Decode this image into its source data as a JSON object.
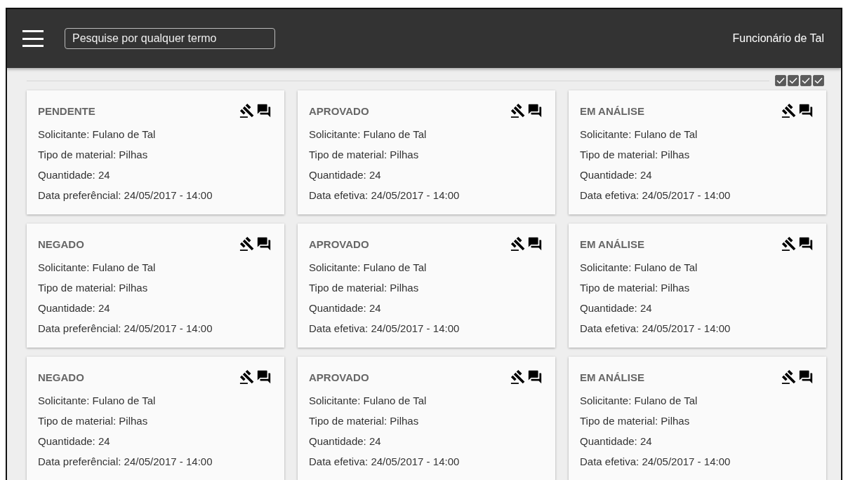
{
  "header": {
    "search": {
      "placeholder": "Pesquise por qualquer termo"
    },
    "user_name": "Funcionário de Tal"
  },
  "checkboxes": [
    {
      "checked": true
    },
    {
      "checked": true
    },
    {
      "checked": true
    },
    {
      "checked": true
    }
  ],
  "cards": [
    {
      "status": "PENDENTE",
      "lines": [
        "Solicitante: Fulano de Tal",
        "Tipo de material: Pilhas",
        "Quantidade: 24",
        "Data preferêncial: 24/05/2017 - 14:00"
      ]
    },
    {
      "status": "APROVADO",
      "lines": [
        "Solicitante: Fulano de Tal",
        "Tipo de material: Pilhas",
        "Quantidade: 24",
        "Data efetiva: 24/05/2017 - 14:00"
      ]
    },
    {
      "status": "EM ANÁLISE",
      "lines": [
        "Solicitante: Fulano de Tal",
        "Tipo de material: Pilhas",
        "Quantidade: 24",
        "Data efetiva: 24/05/2017 - 14:00"
      ]
    },
    {
      "status": "NEGADO",
      "lines": [
        "Solicitante: Fulano de Tal",
        "Tipo de material: Pilhas",
        "Quantidade: 24",
        "Data preferêncial: 24/05/2017 - 14:00"
      ]
    },
    {
      "status": "APROVADO",
      "lines": [
        "Solicitante: Fulano de Tal",
        "Tipo de material: Pilhas",
        "Quantidade: 24",
        "Data efetiva: 24/05/2017 - 14:00"
      ]
    },
    {
      "status": "EM ANÁLISE",
      "lines": [
        "Solicitante: Fulano de Tal",
        "Tipo de material: Pilhas",
        "Quantidade: 24",
        "Data efetiva: 24/05/2017 - 14:00"
      ]
    },
    {
      "status": "NEGADO",
      "lines": [
        "Solicitante: Fulano de Tal",
        "Tipo de material: Pilhas",
        "Quantidade: 24",
        "Data preferêncial: 24/05/2017 - 14:00"
      ]
    },
    {
      "status": "APROVADO",
      "lines": [
        "Solicitante: Fulano de Tal",
        "Tipo de material: Pilhas",
        "Quantidade: 24",
        "Data efetiva: 24/05/2017 - 14:00"
      ]
    },
    {
      "status": "EM ANÁLISE",
      "lines": [
        "Solicitante: Fulano de Tal",
        "Tipo de material: Pilhas",
        "Quantidade: 24",
        "Data efetiva: 24/05/2017 - 14:00"
      ]
    }
  ]
}
